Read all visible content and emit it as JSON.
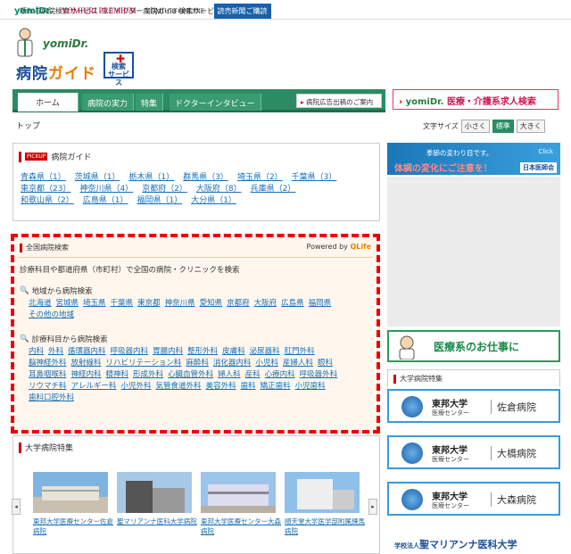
{
  "topbar": {
    "tagline": "頼れる病院検索サービス ヨミドクター病院ガイド検索サービス",
    "links": [
      "yomiDr.",
      "YOMIURI PREMIUM",
      "YOMIURI ONLINE",
      "読売新聞ご購読"
    ]
  },
  "logo": {
    "brand": "yomiDr.",
    "title_a": "病院",
    "title_b": "ガイド",
    "badge": "検索\nサービス"
  },
  "nav": {
    "tabs": [
      "ホーム",
      "病院の実力",
      "特集",
      "ドクターインタビュー"
    ],
    "ad_label": "病院広告出稿のご案内"
  },
  "jobs_link": {
    "brand": "yomiDr.",
    "label": "医療・介護系求人検索"
  },
  "breadcrumb": "トップ",
  "font_size": {
    "label": "文字サイズ",
    "options": [
      "小さく",
      "標準",
      "大きく"
    ],
    "selected": "標準"
  },
  "pickup": {
    "tag": "PICKUP",
    "title": "病院ガイド",
    "prefectures": [
      "青森県（1）",
      "茨城県（1）",
      "栃木県（1）",
      "群馬県（3）",
      "埼玉県（2）",
      "千葉県（3）",
      "東京都（23）",
      "神奈川県（4）",
      "京都府（2）",
      "大阪府（8）",
      "兵庫県（2）",
      "和歌山県（2）",
      "広島県（1）",
      "福岡県（1）",
      "大分県（1）"
    ]
  },
  "search": {
    "title": "全国病院検索",
    "powered": "Powered by",
    "powered_brand": "QLife",
    "description": "診療科目や都道府県（市町村）で全国の病院・クリニックを検索",
    "by_area_title": "地域から病院検索",
    "areas": [
      "北海道",
      "宮城県",
      "埼玉県",
      "千葉県",
      "東京都",
      "神奈川県",
      "愛知県",
      "京都府",
      "大阪府",
      "広島県",
      "福岡県",
      "その他の地域"
    ],
    "by_dept_title": "診療科目から病院検索",
    "depts": [
      "内科",
      "外科",
      "循環器内科",
      "呼吸器内科",
      "胃腸内科",
      "整形外科",
      "皮膚科",
      "泌尿器科",
      "肛門外科",
      "脳神経外科",
      "放射線科",
      "リハビリテーション科",
      "麻酔科",
      "消化器内科",
      "小児科",
      "産婦人科",
      "眼科",
      "耳鼻咽喉科",
      "神経内科",
      "精神科",
      "形成外科",
      "心臓血管外科",
      "婦人科",
      "産科",
      "心療内科",
      "呼吸器外科",
      "リウマチ科",
      "アレルギー科",
      "小児外科",
      "気管食道外科",
      "美容外科",
      "歯科",
      "矯正歯科",
      "小児歯科",
      "歯科口腔外科"
    ]
  },
  "univ": {
    "title": "大学病院特集",
    "captions": [
      "東邦大学医療センター佐倉病院",
      "聖マリアンナ医科大学病院",
      "東邦大学医療センター大森病院",
      "順天堂大学医学部附属練馬病院"
    ]
  },
  "right": {
    "banner_t1": "季節の変わり目です。",
    "banner_t2": "体調の変化にご注意を！",
    "banner_t3": "日本医師会",
    "banner_click": "Click",
    "job_label": "医療系のお仕事に",
    "univ_title": "大学病院特集",
    "unis": [
      {
        "name": "東邦大学",
        "sub": "医療センター",
        "hosp": "佐倉病院"
      },
      {
        "name": "東邦大学",
        "sub": "医療センター",
        "hosp": "大橋病院"
      },
      {
        "name": "東邦大学",
        "sub": "医療センター",
        "hosp": "大森病院"
      }
    ],
    "marianna_pre": "学校法人",
    "marianna": "聖マリアンナ医科大学"
  },
  "colors": {
    "nav_green": "#2b8b62",
    "accent_red": "#d01850",
    "search_border": "#e00"
  }
}
